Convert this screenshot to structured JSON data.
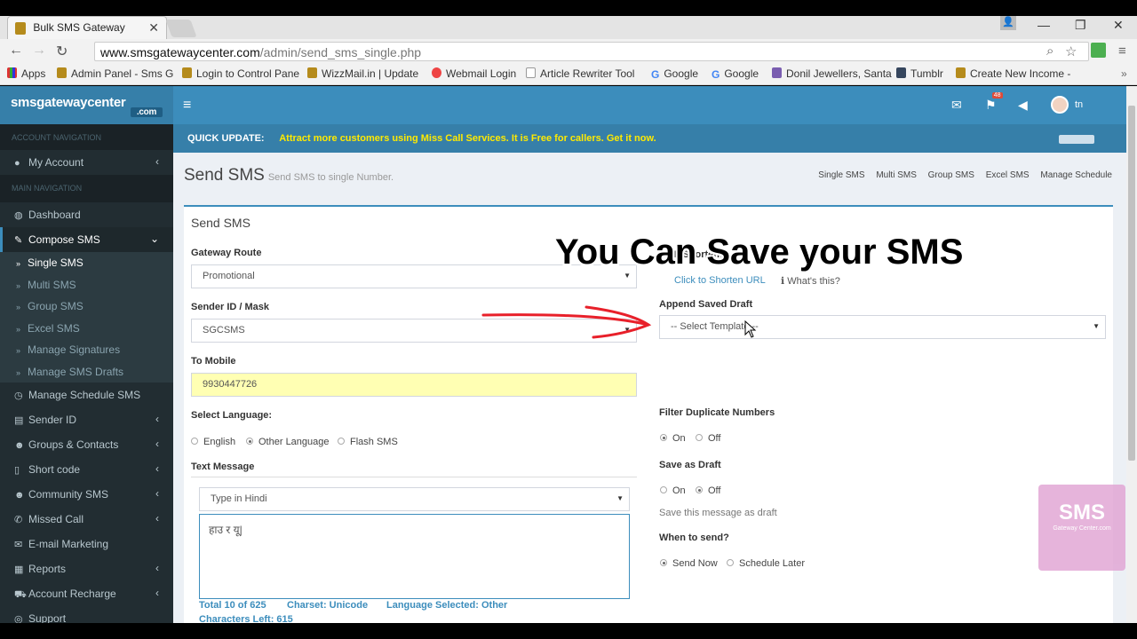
{
  "browser": {
    "tab_title": "Bulk SMS Gateway",
    "url_domain": "www.smsgatewaycenter.com",
    "url_path": "/admin/send_sms_single.php",
    "bookmarks": [
      "Apps",
      "Admin Panel - Sms G",
      "Login to Control Pane",
      "WizzMail.in | Update",
      "Webmail Login",
      "Article Rewriter Tool",
      "Google",
      "Google",
      "Donil Jewellers, Santa",
      "Tumblr",
      "Create New Income -"
    ]
  },
  "header": {
    "logo": "smsgatewaycenter",
    "logo_suffix": ".com",
    "user": "tn",
    "badge_flag": "48"
  },
  "sidebar": {
    "section1": "ACCOUNT NAVIGATION",
    "my_account": "My Account",
    "section2": "MAIN NAVIGATION",
    "dashboard": "Dashboard",
    "compose": "Compose SMS",
    "sub": [
      "Single SMS",
      "Multi SMS",
      "Group SMS",
      "Excel SMS",
      "Manage Signatures",
      "Manage SMS Drafts"
    ],
    "schedule": "Manage Schedule SMS",
    "sender": "Sender ID",
    "groups": "Groups & Contacts",
    "shortcode": "Short code",
    "community": "Community SMS",
    "missed": "Missed Call",
    "email": "E-mail Marketing",
    "reports": "Reports",
    "recharge": "Account Recharge",
    "support": "Support"
  },
  "quick": {
    "label": "QUICK UPDATE:",
    "text": "Attract more customers using Miss Call Services. It is Free for callers. Get it now."
  },
  "page": {
    "title": "Send SMS",
    "subtitle": "Send SMS to single Number.",
    "crumbs": [
      "Single SMS",
      "Multi SMS",
      "Group SMS",
      "Excel SMS",
      "Manage Schedule"
    ]
  },
  "form": {
    "box_title": "Send SMS",
    "route_label": "Gateway Route",
    "route_value": "Promotional",
    "sender_label": "Sender ID / Mask",
    "sender_value": "SGCSMS",
    "mobile_label": "To Mobile",
    "mobile_value": "9930447726",
    "lang_label": "Select Language:",
    "lang_opts": [
      "English",
      "Other Language",
      "Flash SMS"
    ],
    "text_label": "Text Message",
    "type_select": "Type in Hindi",
    "message": "हाउ र यू|",
    "total": "Total 10 of 625",
    "charset": "Charset: Unicode",
    "lang_selected": "Language Selected: Other",
    "chars_left": "Characters Left: 615",
    "url_label": "URL Shortener",
    "shorten": "Click to Shorten URL",
    "whats": "What's this?",
    "draft_label": "Append Saved Draft",
    "draft_placeholder": "-- Select Template --",
    "filter_label": "Filter Duplicate Numbers",
    "on": "On",
    "off": "Off",
    "save_label": "Save as Draft",
    "save_hint": "Save this message as draft",
    "when_label": "When to send?",
    "send_now": "Send Now",
    "later": "Schedule Later"
  },
  "overlay_text": "You Can Save your SMS",
  "watermark": {
    "big": "SMS",
    "small": "Gateway Center.com"
  }
}
